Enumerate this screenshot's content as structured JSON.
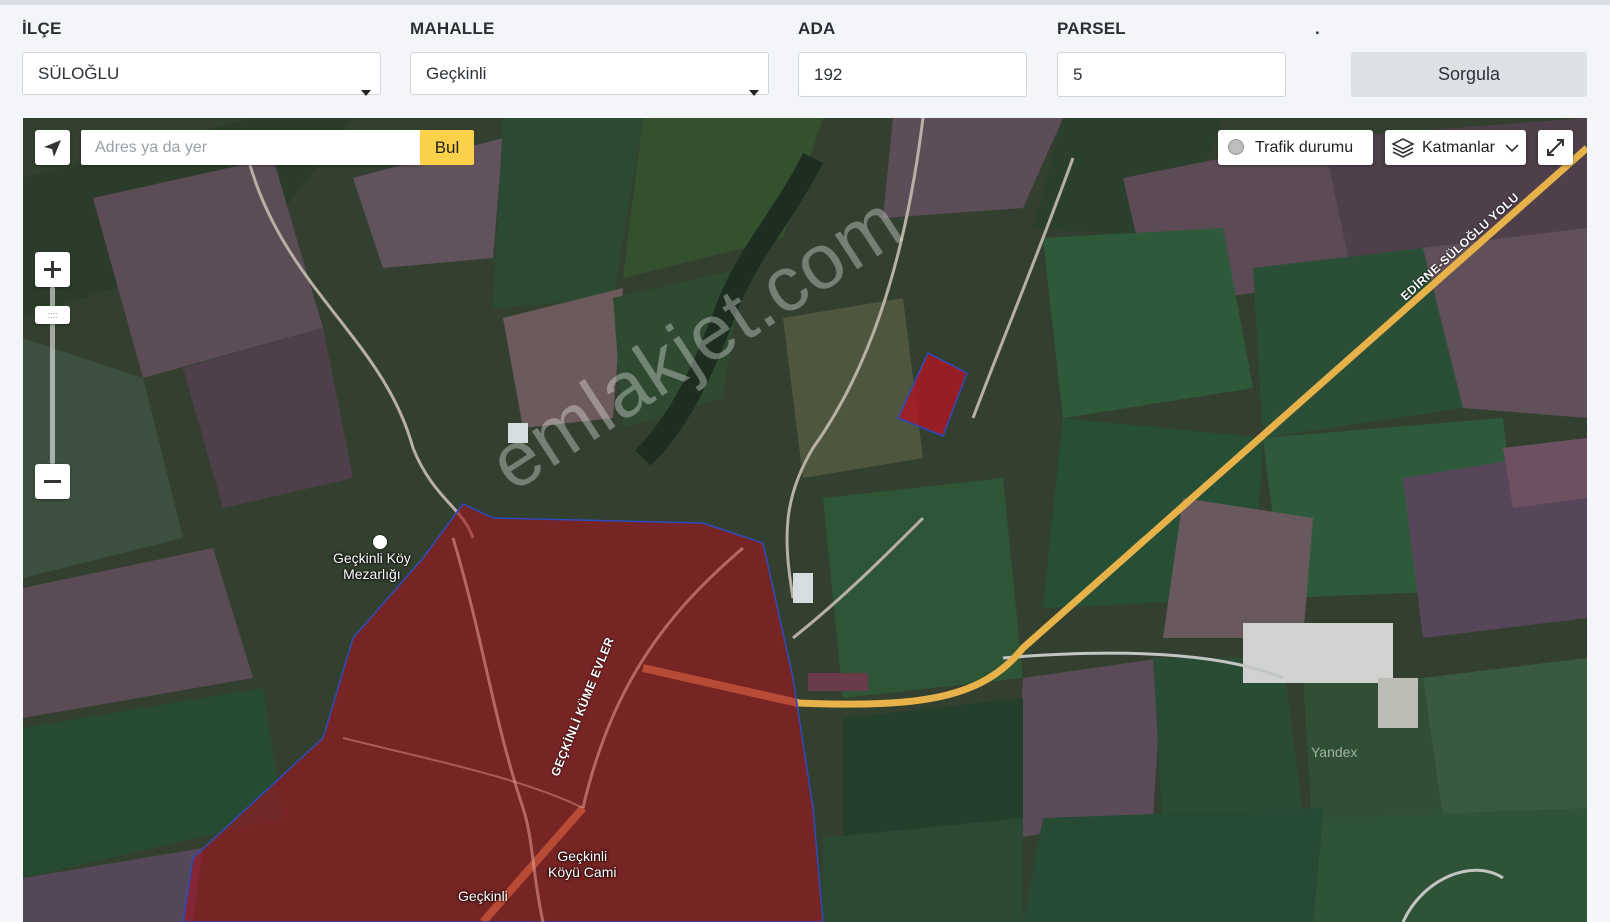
{
  "form": {
    "district": {
      "label": "İLÇE",
      "value": "SÜLOĞLU"
    },
    "neighborhood": {
      "label": "MAHALLE",
      "value": "Geçkinli"
    },
    "block": {
      "label": "ADA",
      "value": "192"
    },
    "parcel": {
      "label": "PARSEL",
      "value": "5"
    },
    "action": {
      "label": ".",
      "button": "Sorgula"
    }
  },
  "map": {
    "search": {
      "placeholder": "Adres ya da yer",
      "button": "Bul"
    },
    "traffic_label": "Trafik durumu",
    "layers_label": "Katmanlar",
    "labels": {
      "cemetery": "Geçkinli Köy\nMezarlığı",
      "mosque": "Geçkinli\nKöyü Cami",
      "village": "Geçkinli",
      "road_village": "GEÇKİNLİ KÜME EVLER",
      "road_highway": "EDİRNE-SÜLOĞLU YOLU"
    },
    "brand": "Yandex",
    "watermark": "emlakjet.com",
    "icons": [
      "locate-icon",
      "traffic-icon",
      "layers-icon",
      "chevron-down-icon",
      "fullscreen-icon",
      "zoom-in-icon",
      "zoom-out-icon",
      "cemetery-icon"
    ],
    "colors": {
      "highlight": "#a0141e",
      "highlight_border": "#2b4bbf",
      "road": "#e8b24a",
      "search_button": "#fcd14a"
    }
  }
}
